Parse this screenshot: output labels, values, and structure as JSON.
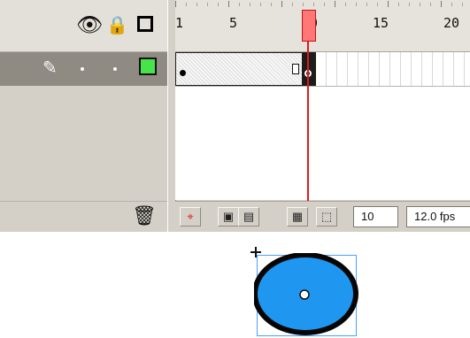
{
  "timeline": {
    "ruler_labels": [
      "1",
      "5",
      "10",
      "15",
      "20"
    ],
    "current_frame": "10",
    "frame_rate": "12.0 fps"
  },
  "layer": {
    "row_icons": [
      "pencil-icon",
      "dot-icon",
      "dot-icon",
      "square-outline-icon"
    ]
  },
  "toolbar": {
    "buttons": [
      "center-frame-icon",
      "onion-skin-icon",
      "onion-skin-outlines-icon",
      "edit-multiple-frames-icon",
      "modify-onion-markers-icon"
    ]
  },
  "colors": {
    "panel": "#d4d0c8",
    "layer_row": "#8f8a82",
    "playhead": "#e21919",
    "circle_fill": "#1f97f1",
    "circle_stroke": "#050505",
    "selection": "#4aa1ff",
    "keyframe_green": "#47e34a"
  }
}
